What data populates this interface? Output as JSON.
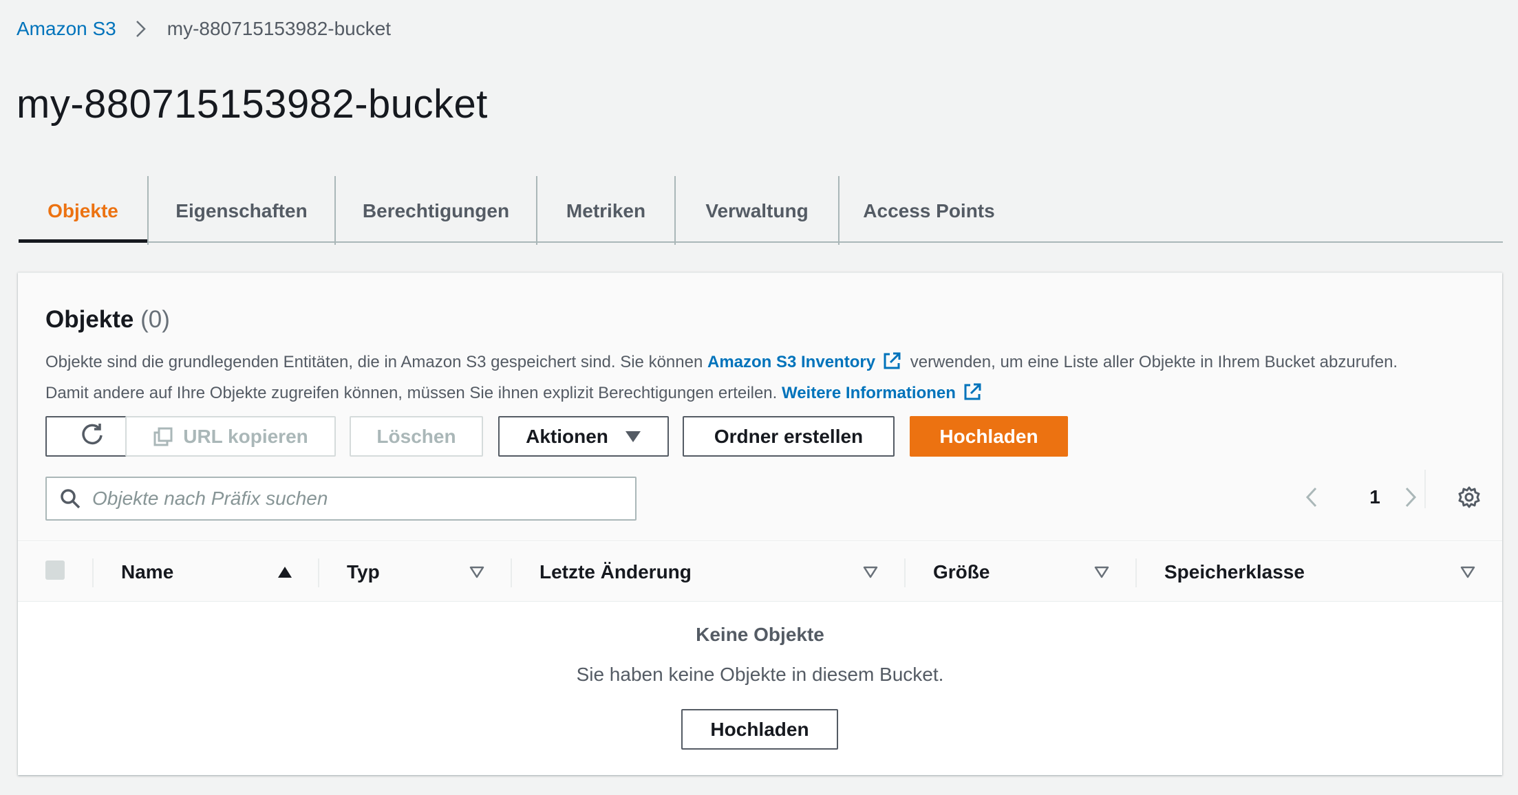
{
  "breadcrumb": {
    "root": "Amazon S3",
    "current": "my-880715153982-bucket"
  },
  "page": {
    "title": "my-880715153982-bucket"
  },
  "tabs": [
    {
      "label": "Objekte",
      "active": true
    },
    {
      "label": "Eigenschaften",
      "active": false
    },
    {
      "label": "Berechtigungen",
      "active": false
    },
    {
      "label": "Metriken",
      "active": false
    },
    {
      "label": "Verwaltung",
      "active": false
    },
    {
      "label": "Access Points",
      "active": false
    }
  ],
  "objects_panel": {
    "title": "Objekte",
    "count": "(0)",
    "description": {
      "line1_before": "Objekte sind die grundlegenden Entitäten, die in Amazon S3 gespeichert sind. Sie können ",
      "inventory_link": "Amazon S3 Inventory",
      "line1_after": " verwenden, um eine Liste aller Objekte in Ihrem Bucket abzurufen.",
      "line2_before": "Damit andere auf Ihre Objekte zugreifen können, müssen Sie ihnen explizit Berechtigungen erteilen. ",
      "more_info_link": "Weitere Informationen"
    },
    "toolbar": {
      "copy_url": "URL kopieren",
      "delete": "Löschen",
      "actions": "Aktionen",
      "create_folder": "Ordner erstellen",
      "upload": "Hochladen"
    },
    "search": {
      "placeholder": "Objekte nach Präfix suchen",
      "value": ""
    },
    "pagination": {
      "current_page": "1"
    },
    "table": {
      "columns": [
        {
          "label": "Name",
          "sort": "ascending"
        },
        {
          "label": "Typ",
          "sort": "none"
        },
        {
          "label": "Letzte Änderung",
          "sort": "none"
        },
        {
          "label": "Größe",
          "sort": "none"
        },
        {
          "label": "Speicherklasse",
          "sort": "none"
        }
      ],
      "rows": []
    },
    "empty_state": {
      "title": "Keine Objekte",
      "description": "Sie haben keine Objekte in diesem Bucket.",
      "upload_button": "Hochladen"
    }
  },
  "colors": {
    "accent": "#ec7211",
    "link": "#0073bb",
    "text": "#16191f",
    "muted": "#545b64",
    "background": "#f2f3f3"
  },
  "icons": [
    "chevron-right-icon",
    "external-link-icon",
    "refresh-icon",
    "copy-icon",
    "caret-down-icon",
    "search-icon",
    "chevron-left-icon",
    "gear-icon",
    "sort-asc-icon",
    "sort-desc-icon"
  ]
}
